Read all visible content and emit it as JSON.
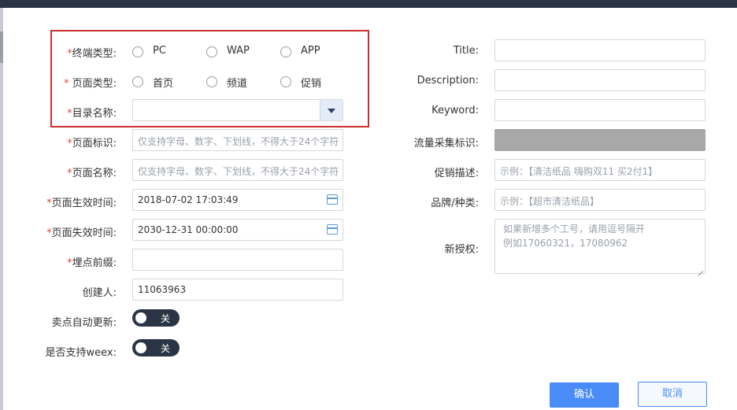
{
  "form": {
    "terminal_type": {
      "required": "*",
      "label": "终端类型:",
      "options": [
        "PC",
        "WAP",
        "APP"
      ]
    },
    "page_type": {
      "required": "*",
      "label": " 页面类型:",
      "options": [
        "首页",
        "频道",
        "促销"
      ]
    },
    "directory_name": {
      "required": "*",
      "label": "目录名称:",
      "value": ""
    },
    "page_id": {
      "required": "*",
      "label": "页面标识:",
      "placeholder": "仅支持字母、数字、下划线，不得大于24个字符"
    },
    "page_name": {
      "required": "*",
      "label": "页面名称:",
      "placeholder": "仅支持字母、数字、下划线，不得大于24个字符"
    },
    "effective_time": {
      "required": "*",
      "label": "页面生效时间:",
      "value": "2018-07-02 17:03:49"
    },
    "expire_time": {
      "required": "*",
      "label": "页面失效时间:",
      "value": "2030-12-31 00:00:00"
    },
    "tracking_prefix": {
      "required": "*",
      "label": "埋点前缀:",
      "value": ""
    },
    "creator": {
      "label": "创建人:",
      "value": "11063963"
    },
    "auto_update": {
      "label": "卖点自动更新:",
      "state": "关"
    },
    "weex": {
      "label": "是否支持weex:",
      "state": "关"
    },
    "title": {
      "label": "Title:",
      "value": ""
    },
    "description": {
      "label": "Description:",
      "value": ""
    },
    "keyword": {
      "label": "Keyword:",
      "value": ""
    },
    "traffic_id": {
      "label": "流量采集标识:"
    },
    "promo_desc": {
      "label": "促销描述:",
      "placeholder": "示例：【清洁纸品 嗨购双11  买2付1】"
    },
    "brand_category": {
      "label": "品牌/种类:",
      "placeholder": "示例：【超市清洁纸品】"
    },
    "new_auth": {
      "label": "新授权:",
      "placeholder_line1": "如果新增多个工号，请用逗号隔开",
      "placeholder_line2": "例如17060321，17080962"
    }
  },
  "buttons": {
    "confirm": "确认",
    "cancel": "取消"
  },
  "colors": {
    "primary": "#4a8cf7",
    "required": "#e0483e",
    "highlight_box": "#c9302c",
    "toggle_bg": "#2b3445"
  }
}
